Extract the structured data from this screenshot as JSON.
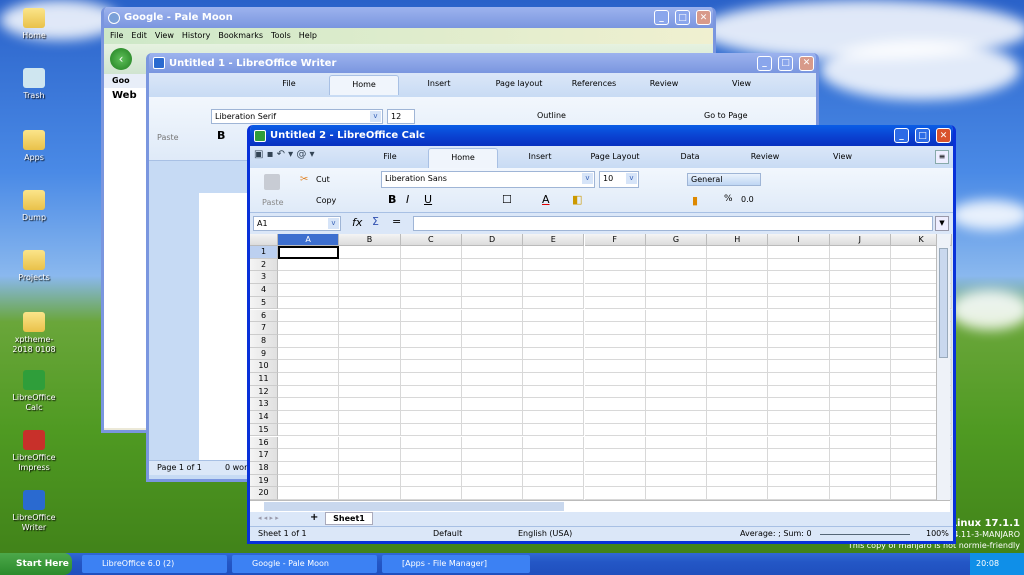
{
  "desktop": {
    "icons": [
      {
        "label": "Home"
      },
      {
        "label": "Trash"
      },
      {
        "label": "Apps"
      },
      {
        "label": "Dump"
      },
      {
        "label": "Projects"
      },
      {
        "label": "xptheme-2018 0108"
      },
      {
        "label": "LibreOffice Calc"
      },
      {
        "label": "LibreOffice Impress"
      },
      {
        "label": "LibreOffice Writer"
      }
    ],
    "watermark": {
      "line1": "Linux 17.1.1",
      "line2": "4.11-3-MANJARO",
      "line3": "This copy of manjaro is not normie-friendly"
    }
  },
  "palemoon": {
    "title": "Google - Pale Moon",
    "menu": [
      "File",
      "Edit",
      "View",
      "History",
      "Bookmarks",
      "Tools",
      "Help"
    ],
    "tab": "Goo",
    "web": "Web"
  },
  "writer": {
    "title": "Untitled 1 - LibreOffice Writer",
    "tabs": [
      "File",
      "Home",
      "Insert",
      "Page layout",
      "References",
      "Review",
      "View"
    ],
    "font": "Liberation Serif",
    "size": "12",
    "paste": "Paste",
    "outline": "Outline",
    "goto": "Go to Page",
    "status_page": "Page 1 of 1",
    "status_words": "0 wor"
  },
  "calc": {
    "title": "Untitled 2 - LibreOffice Calc",
    "tabs": [
      "File",
      "Home",
      "Insert",
      "Page Layout",
      "Data",
      "Review",
      "View"
    ],
    "ribbon": {
      "paste": "Paste",
      "cut": "Cut",
      "copy": "Copy",
      "font": "Liberation Sans",
      "size": "10",
      "number_format": "General",
      "percent": "%",
      "decimal": "0.0"
    },
    "namebox": "A1",
    "formula": "",
    "columns": [
      "A",
      "B",
      "C",
      "D",
      "E",
      "F",
      "G",
      "H",
      "I",
      "J",
      "K"
    ],
    "rows": [
      "1",
      "2",
      "3",
      "4",
      "5",
      "6",
      "7",
      "8",
      "9",
      "10",
      "11",
      "12",
      "13",
      "14",
      "15",
      "16",
      "17",
      "18",
      "19",
      "20"
    ],
    "sheet_tab": "Sheet1",
    "add_sheet": "+",
    "status": {
      "sheet": "Sheet 1 of 1",
      "style": "Default",
      "lang": "English (USA)",
      "sum": "Average: ; Sum: 0",
      "zoom": "100%"
    }
  },
  "taskbar": {
    "start": "Start Here",
    "items": [
      "LibreOffice 6.0 (2)",
      "Google - Pale Moon",
      "[Apps - File Manager]"
    ],
    "clock": "20:08"
  }
}
